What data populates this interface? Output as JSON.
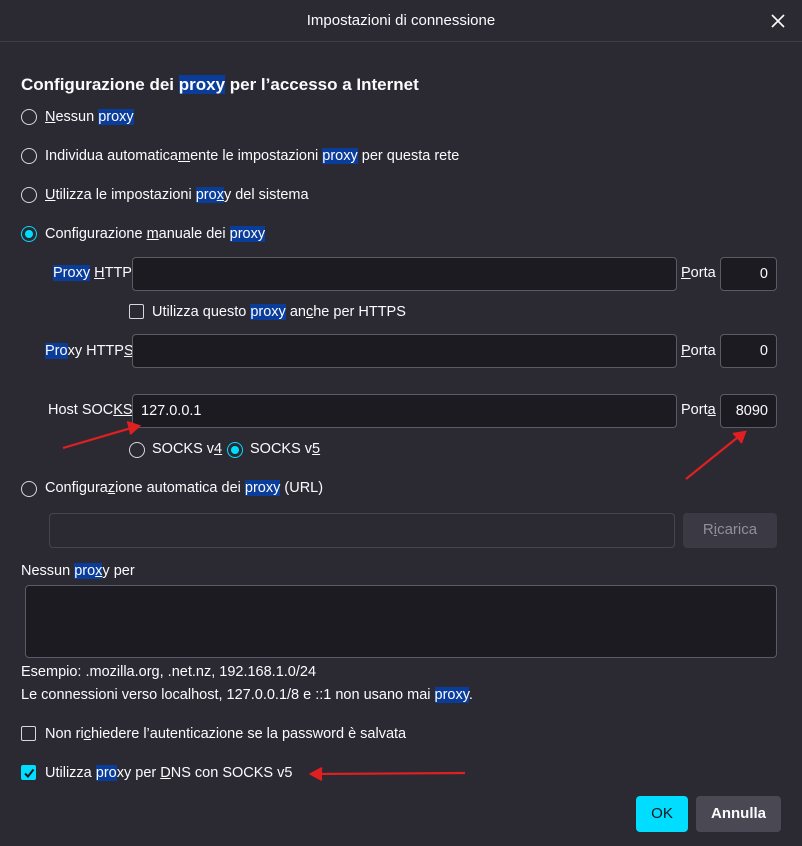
{
  "window": {
    "title": "Impostazioni di connessione"
  },
  "section": {
    "heading_a": "Configurazione dei ",
    "heading_hl": "proxy",
    "heading_b": " per l’accesso a Internet"
  },
  "options": {
    "no_proxy": {
      "u": "N",
      "a": "essun ",
      "hl": "proxy",
      "checked": false
    },
    "auto_detect": {
      "a": "Individua automatica",
      "u": "m",
      "b": "ente le impostazioni ",
      "hl": "proxy",
      "c": " per questa rete",
      "checked": false
    },
    "system": {
      "u": "U",
      "a": "tilizza le impostazioni ",
      "hl": "pro",
      "b": "x",
      "c": "y del sistema",
      "checked": false
    },
    "manual": {
      "a": "Configurazione ",
      "u": "m",
      "b": "anuale dei ",
      "hl": "proxy",
      "checked": true
    },
    "pac": {
      "a": "Configura",
      "u": "z",
      "b": "ione automatica dei ",
      "hl": "proxy",
      "c": " (URL)",
      "checked": false
    }
  },
  "manual": {
    "http_label_hl": "Proxy",
    "http_label_b": " ",
    "http_label_u": "H",
    "http_label_c": "TTP",
    "http_value": "",
    "http_port_label_u": "P",
    "http_port_label_b": "orta",
    "http_port": "0",
    "also_https_a": "Utilizza questo ",
    "also_https_hl": "proxy",
    "also_https_b": " an",
    "also_https_u": "c",
    "also_https_c": "he per HTTPS",
    "also_https_checked": false,
    "https_label_hl": "Pro",
    "https_label_b": "xy HTTP",
    "https_label_u": "S",
    "https_value": "",
    "https_port_label_u": "P",
    "https_port_label_b": "orta",
    "https_port": "0",
    "socks_label_a": "Host SOC",
    "socks_label_u": "KS",
    "socks_value": "127.0.0.1",
    "socks_port_label_a": "Port",
    "socks_port_label_u": "a",
    "socks_port": "8090",
    "socks_v4_a": "SOCKS v",
    "socks_v4_u": "4",
    "socks_v5_a": "SOCKS v",
    "socks_v5_u": "5",
    "socks_version": "v5"
  },
  "pac": {
    "url_value": "",
    "reload_a": "R",
    "reload_u": "i",
    "reload_b": "carica"
  },
  "no_proxy_for": {
    "label_a": "Nessun ",
    "label_hl": "pro",
    "label_b": "x",
    "label_c": "y per",
    "value": "",
    "example": "Esempio: .mozilla.org, .net.nz, 192.168.1.0/24",
    "localhost_a": "Le connessioni verso localhost, 127.0.0.1/8 e ::1 non usano mai ",
    "localhost_hl": "proxy",
    "localhost_b": "."
  },
  "auth": {
    "a": "Non ri",
    "u": "c",
    "b": "hiedere l’autenticazione se la password è salvata",
    "checked": false
  },
  "dns": {
    "a": "Utilizza ",
    "hl": "pro",
    "b": "xy per ",
    "u": "D",
    "c": "NS con SOCKS v5",
    "checked": true
  },
  "buttons": {
    "ok": "OK",
    "cancel": "Annulla"
  },
  "colors": {
    "background": "#2b2a33",
    "accent": "#00ddff",
    "highlight": "#0a3d99",
    "annotation_arrow": "#e02020"
  }
}
